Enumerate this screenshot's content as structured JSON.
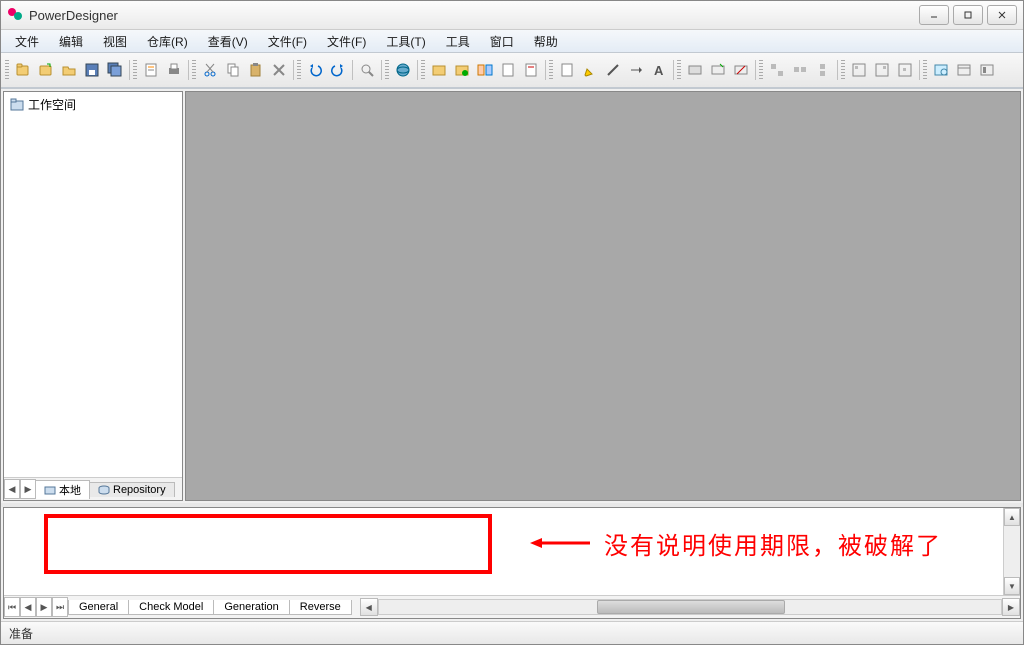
{
  "title": "PowerDesigner",
  "menus": [
    "文件",
    "编辑",
    "视图",
    "仓库(R)",
    "查看(V)",
    "文件(F)",
    "文件(F)",
    "工具(T)",
    "工具",
    "窗口",
    "帮助"
  ],
  "tree": {
    "root_label": "工作空间"
  },
  "tree_tabs": {
    "local": "本地",
    "repository": "Repository"
  },
  "bottom_tabs": [
    "General",
    "Check Model",
    "Generation",
    "Reverse"
  ],
  "annotation_text": "没有说明使用期限，被破解了",
  "status": "准备",
  "toolbar_icons": [
    "new-project",
    "new-model",
    "open",
    "save",
    "save-all",
    "sep",
    "properties",
    "sheet",
    "sep",
    "cut",
    "copy",
    "paste",
    "delete",
    "sep",
    "undo",
    "redo",
    "sep",
    "find",
    "sep",
    "browser",
    "sep",
    "model-a",
    "model-b",
    "model-c",
    "compare-a",
    "compare-b",
    "sep",
    "page-a",
    "edit-a",
    "line-a",
    "arrow-b",
    "text-a",
    "sep",
    "rect-a",
    "rect-b",
    "rect-c",
    "sep",
    "btn-x1",
    "btn-x2",
    "btn-x3",
    "sep",
    "btn-y1",
    "btn-y2",
    "btn-y3",
    "sep",
    "view-a",
    "view-b",
    "view-c"
  ]
}
